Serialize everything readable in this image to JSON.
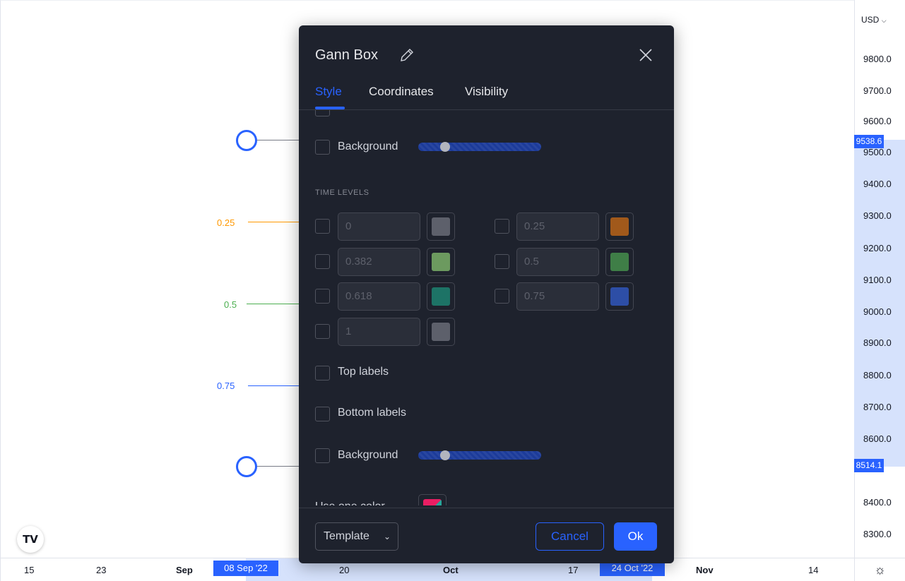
{
  "dialog": {
    "title": "Gann Box",
    "tabs": [
      {
        "label": "Style",
        "active": true
      },
      {
        "label": "Coordinates",
        "active": false
      },
      {
        "label": "Visibility",
        "active": false
      }
    ],
    "background_top_label": "Background",
    "time_levels_title": "TIME LEVELS",
    "levels_left": [
      {
        "value": "0",
        "color": "#5d606b"
      },
      {
        "value": "0.382",
        "color": "#6c9a5f"
      },
      {
        "value": "0.618",
        "color": "#1d7366"
      },
      {
        "value": "1",
        "color": "#5d606b"
      }
    ],
    "levels_right": [
      {
        "value": "0.25",
        "color": "#a1591b"
      },
      {
        "value": "0.5",
        "color": "#3f7e47"
      },
      {
        "value": "0.75",
        "color": "#2d4ea6"
      }
    ],
    "top_labels": "Top labels",
    "bottom_labels": "Bottom labels",
    "background_bottom_label": "Background",
    "use_one_color": "Use one color",
    "template_label": "Template",
    "cancel_label": "Cancel",
    "ok_label": "Ok"
  },
  "chart": {
    "level_labels": [
      {
        "label": "0.25",
        "color": "#ff9800"
      },
      {
        "label": "0.5",
        "color": "#4caf50"
      },
      {
        "label": "0.75",
        "color": "#2962ff"
      }
    ],
    "logo": "TV"
  },
  "price_axis": {
    "currency": "USD",
    "labels": [
      "9800.0",
      "9700.0",
      "9600.0",
      "9500.0",
      "9400.0",
      "9300.0",
      "9200.0",
      "9100.0",
      "9000.0",
      "8900.0",
      "8800.0",
      "8700.0",
      "8600.0",
      "8400.0",
      "8300.0"
    ],
    "tag_top": "9538.6",
    "tag_bottom": "8514.1"
  },
  "time_axis": {
    "labels": [
      {
        "text": "15",
        "bold": false
      },
      {
        "text": "23",
        "bold": false
      },
      {
        "text": "Sep",
        "bold": true
      },
      {
        "text": "20",
        "bold": false
      },
      {
        "text": "Oct",
        "bold": true
      },
      {
        "text": "17",
        "bold": false
      },
      {
        "text": "Nov",
        "bold": true
      },
      {
        "text": "14",
        "bold": false
      }
    ],
    "tag_left": "08 Sep '22",
    "tag_right": "24 Oct '22"
  }
}
